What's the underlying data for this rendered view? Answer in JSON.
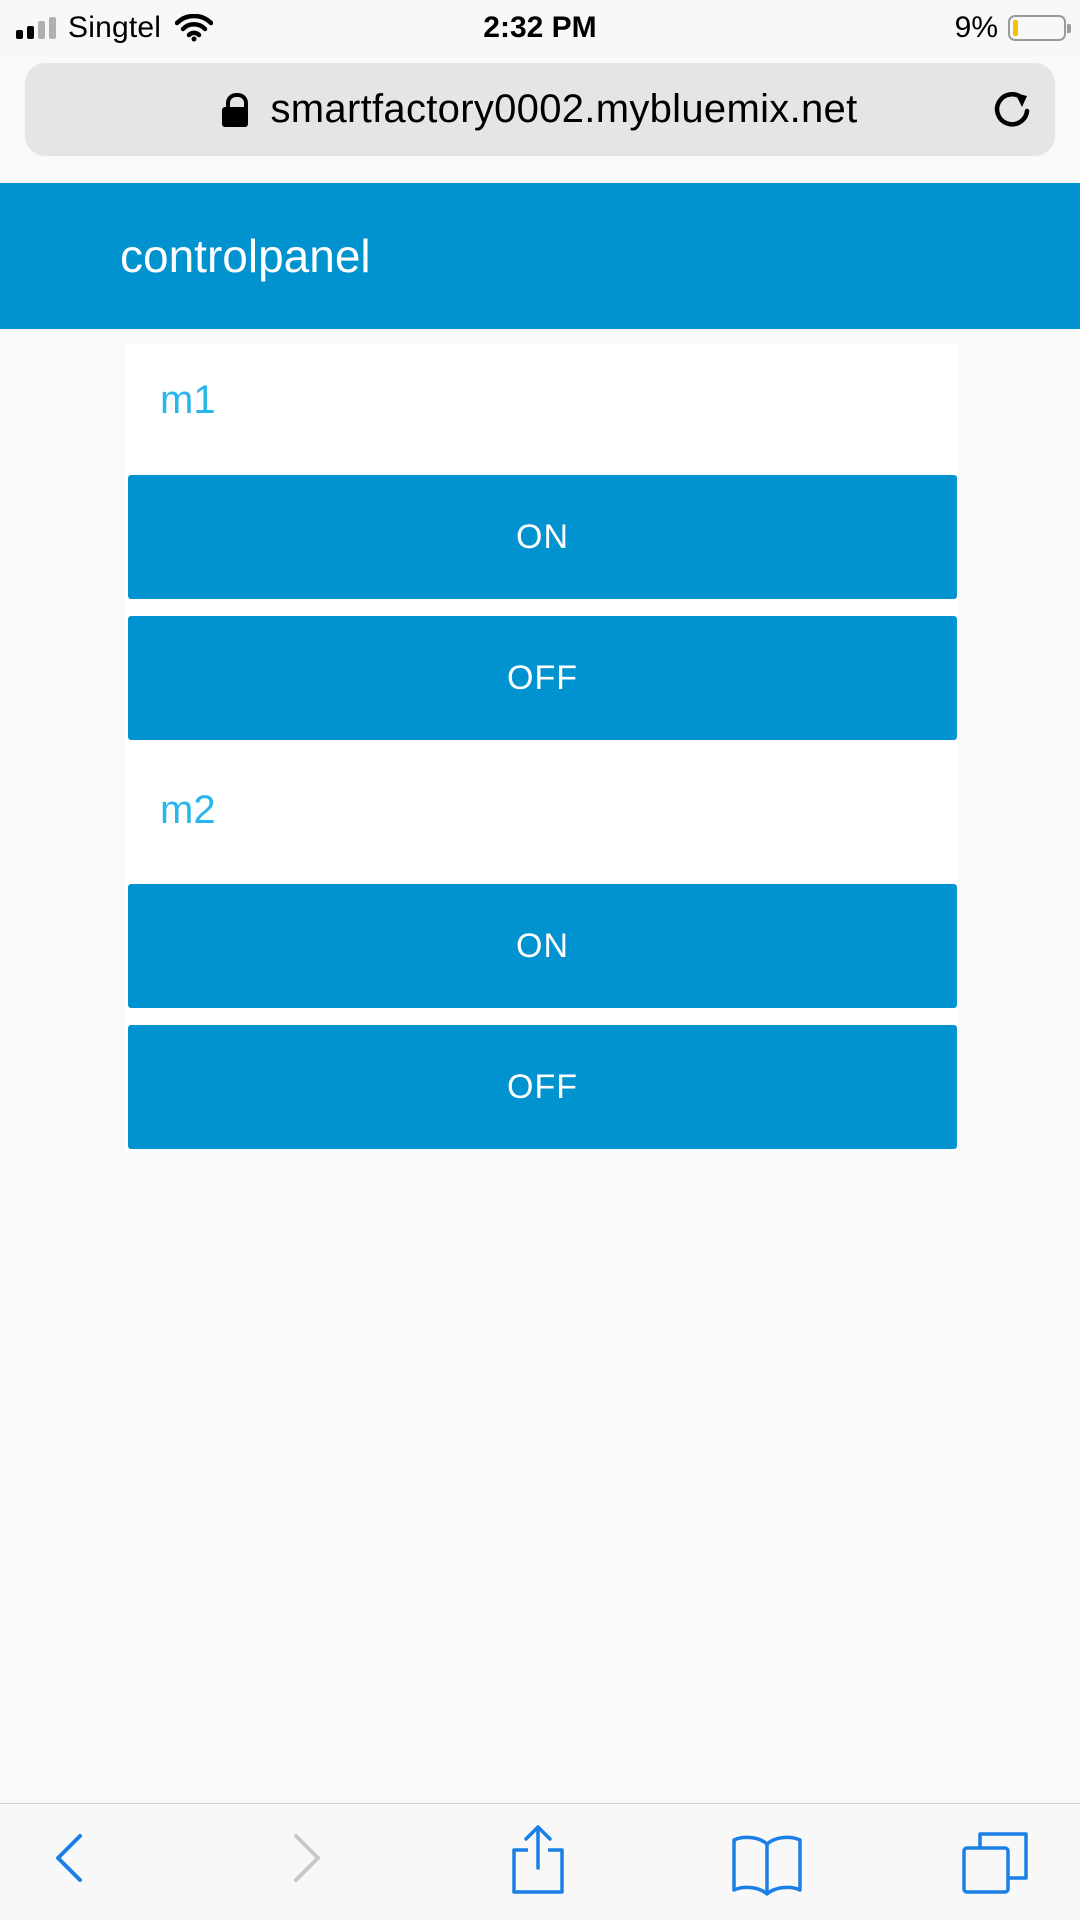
{
  "status_bar": {
    "carrier": "Singtel",
    "time": "2:32 PM",
    "battery_percent": "9%",
    "battery_level": 0.09,
    "battery_color": "#f5c400"
  },
  "browser": {
    "url": "smartfactory0002.mybluemix.net",
    "lock_icon": "lock-icon",
    "reload_icon": "reload-icon"
  },
  "app": {
    "title": "controlpanel",
    "header_color": "#0093d0",
    "label_color": "#28b7ec"
  },
  "controls": [
    {
      "label": "m1",
      "on_label": "ON",
      "off_label": "OFF"
    },
    {
      "label": "m2",
      "on_label": "ON",
      "off_label": "OFF"
    }
  ],
  "toolbar": {
    "icons": [
      "back-icon",
      "forward-icon",
      "share-icon",
      "bookmarks-icon",
      "tabs-icon"
    ],
    "accent_color": "#1a7fe6"
  }
}
